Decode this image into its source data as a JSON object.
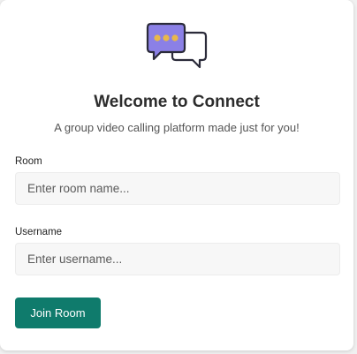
{
  "header": {
    "logo_icon": "chat-bubbles-icon",
    "title": "Welcome to Connect",
    "subtitle": "A group video calling platform made just for you!"
  },
  "form": {
    "room": {
      "label": "Room",
      "placeholder": "Enter room name...",
      "value": ""
    },
    "username": {
      "label": "Username",
      "placeholder": "Enter username...",
      "value": ""
    },
    "submit_label": "Join Room"
  },
  "colors": {
    "accent": "#0f7b6c",
    "logo_bubble": "#8b80e6",
    "logo_dots": "#e8b84a",
    "logo_outline": "#2b2b3a"
  }
}
